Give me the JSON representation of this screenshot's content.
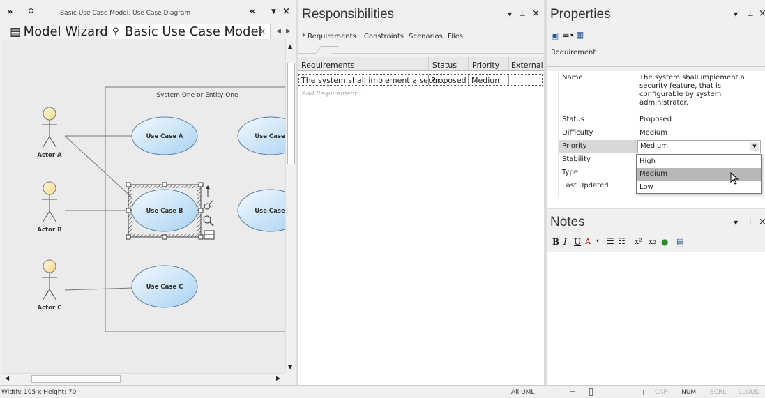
{
  "left_panel": {
    "breadcrumb": "Basic Use Case Model.  Use Case Diagram",
    "tabs": [
      {
        "label": "Model Wizard"
      },
      {
        "label": "Basic Use Case Model"
      }
    ],
    "close_glyph": "×",
    "boundary_label": "System One or Entity One",
    "actors": [
      {
        "label": "Actor A"
      },
      {
        "label": "Actor B"
      },
      {
        "label": "Actor C"
      }
    ],
    "use_cases": [
      {
        "label": "Use Case A"
      },
      {
        "label": "Use Case B"
      },
      {
        "label": "Use Case C"
      },
      {
        "label": "Use Case"
      },
      {
        "label": "Use Case"
      }
    ]
  },
  "responsibilities": {
    "title": "Responsibilities",
    "tabs": [
      "* Requirements",
      "Constraints",
      "Scenarios",
      "Files"
    ],
    "columns": [
      "Requirements",
      "Status",
      "Priority",
      "External"
    ],
    "rows": [
      {
        "requirement": "The system shall implement a secur...",
        "status": "Proposed",
        "priority": "Medium",
        "external": ""
      }
    ],
    "add_placeholder": "Add Requirement..."
  },
  "properties": {
    "title": "Properties",
    "subtab": "Requirement",
    "name_label": "Name",
    "name_value": "The system shall implement a security feature, that is configurable by system administrator.",
    "rows": [
      {
        "key": "Status",
        "value": "Proposed"
      },
      {
        "key": "Difficulty",
        "value": "Medium"
      },
      {
        "key": "Priority",
        "value": "Medium"
      },
      {
        "key": "Stability",
        "value": "High"
      },
      {
        "key": "Type",
        "value": ""
      },
      {
        "key": "Last Updated",
        "value": ""
      }
    ],
    "dropdown_options": [
      "High",
      "Medium",
      "Low"
    ],
    "dropdown_selected": "Medium"
  },
  "notes": {
    "title": "Notes",
    "toolbar": {
      "bold": "B",
      "italic": "I",
      "underline": "U",
      "superscript": "x²",
      "subscript": "x₂"
    }
  },
  "status_bar": {
    "dimensions": "Width:  105 x Height:  70",
    "mode": "All UML",
    "indicators": [
      "CAP",
      "NUM",
      "SCRL",
      "CLOUD"
    ]
  },
  "colors": {
    "usecase_fill_light": "#e8f4fd",
    "usecase_fill_dark": "#a9d2f2",
    "usecase_stroke": "#5a7fa6",
    "actor_fill": "#fdecb8",
    "selection_row": "#d8d8d8"
  }
}
